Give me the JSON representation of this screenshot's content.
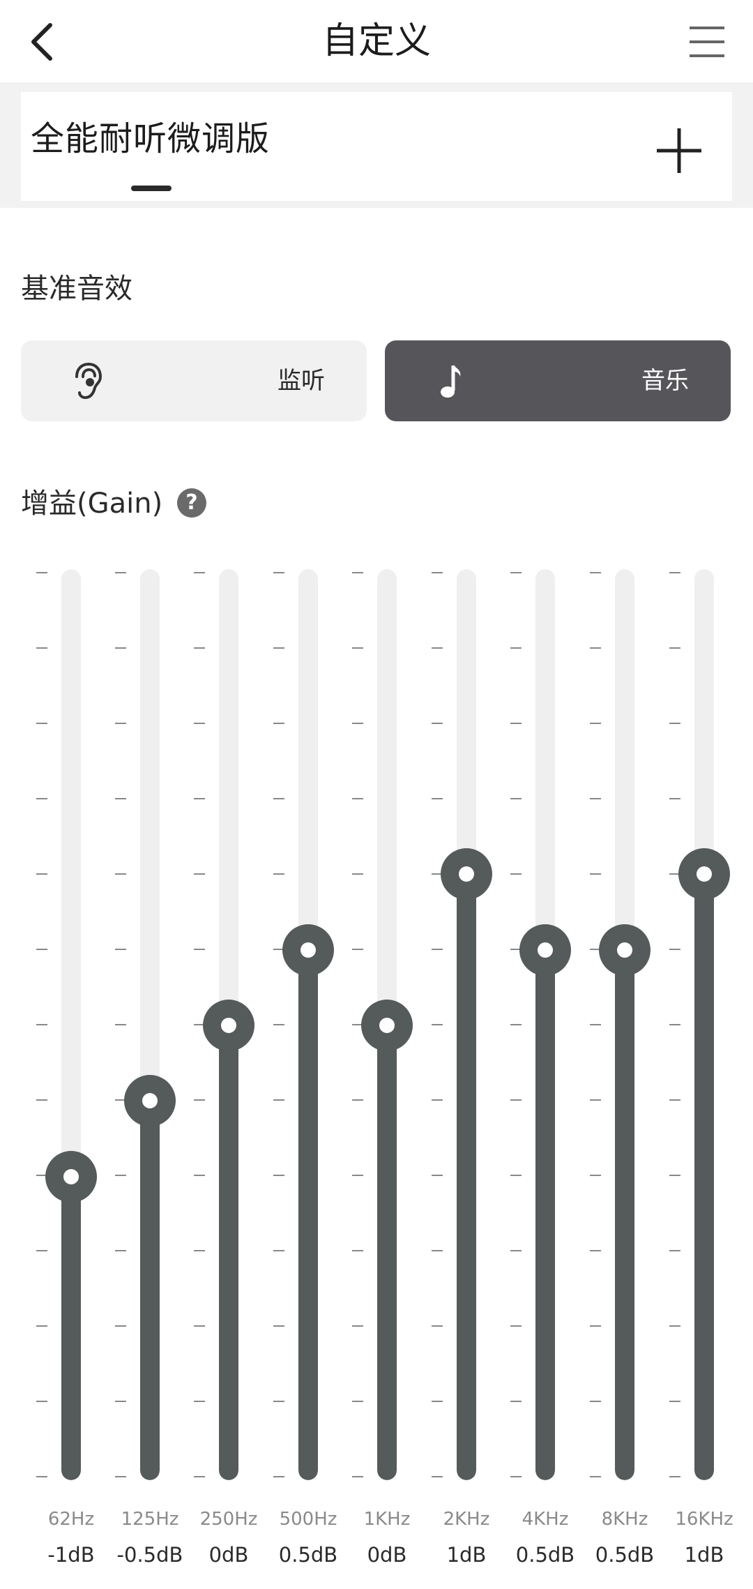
{
  "header": {
    "title": "自定义",
    "back_icon": "chevron-left-icon",
    "menu_icon": "menu-icon"
  },
  "presets": {
    "active_tab": "全能耐听微调版",
    "add_icon": "plus-icon"
  },
  "base_effect": {
    "label": "基准音效",
    "modes": [
      {
        "label": "监听",
        "icon": "ear-icon",
        "selected": false
      },
      {
        "label": "音乐",
        "icon": "music-note-icon",
        "selected": true
      }
    ]
  },
  "gain": {
    "label": "增益(Gain)",
    "help_icon": "question-mark-icon",
    "help_text": "?",
    "min_db": -3,
    "max_db": 3,
    "colors": {
      "track": "#efefef",
      "fill": "#555a5a",
      "selected_button": "#55555a"
    },
    "bands": [
      {
        "freq": "62Hz",
        "gain_label": "-1dB",
        "gain": -1
      },
      {
        "freq": "125Hz",
        "gain_label": "-0.5dB",
        "gain": -0.5
      },
      {
        "freq": "250Hz",
        "gain_label": "0dB",
        "gain": 0
      },
      {
        "freq": "500Hz",
        "gain_label": "0.5dB",
        "gain": 0.5
      },
      {
        "freq": "1KHz",
        "gain_label": "0dB",
        "gain": 0
      },
      {
        "freq": "2KHz",
        "gain_label": "1dB",
        "gain": 1
      },
      {
        "freq": "4KHz",
        "gain_label": "0.5dB",
        "gain": 0.5
      },
      {
        "freq": "8KHz",
        "gain_label": "0.5dB",
        "gain": 0.5
      },
      {
        "freq": "16KHz",
        "gain_label": "1dB",
        "gain": 1
      }
    ]
  }
}
